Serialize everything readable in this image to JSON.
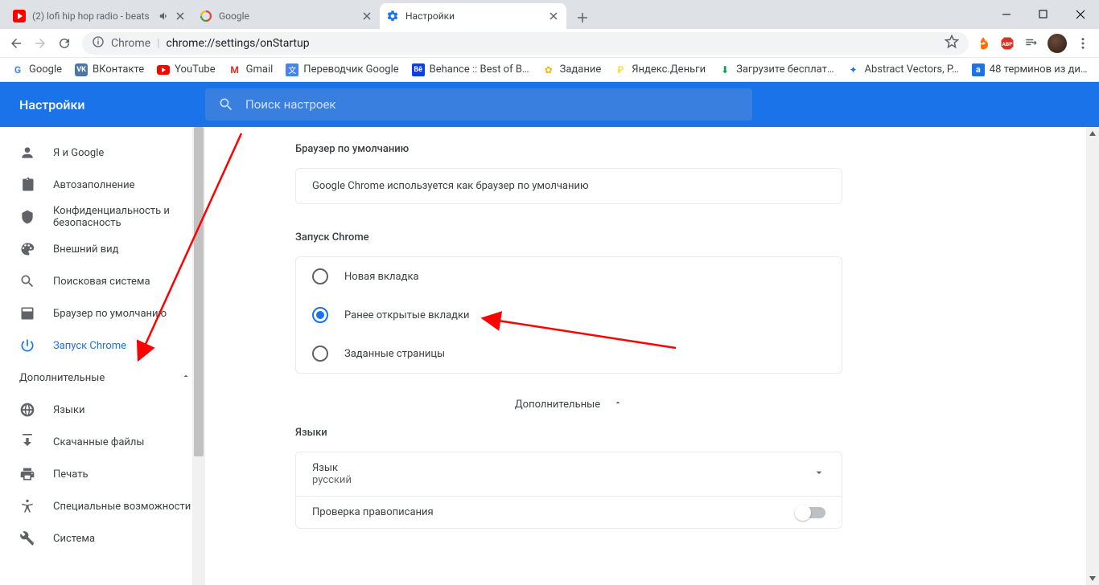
{
  "tabs": [
    {
      "title": "(2) lofi hip hop radio - beats",
      "favicon": "youtube",
      "audio": true
    },
    {
      "title": "Google",
      "favicon": "google"
    },
    {
      "title": "Настройки",
      "favicon": "settings",
      "active": true
    }
  ],
  "omnibox": {
    "chip": "Chrome",
    "url": "chrome://settings/onStartup"
  },
  "bookmarks": [
    {
      "label": "Google",
      "icon": "G",
      "color": "#4285f4"
    },
    {
      "label": "ВКонтакте",
      "icon": "VK",
      "color": "#4a76a8"
    },
    {
      "label": "YouTube",
      "icon": "▶",
      "color": "#ff0000"
    },
    {
      "label": "Gmail",
      "icon": "M",
      "color": "#d93025"
    },
    {
      "label": "Переводчик Google",
      "icon": "⇄",
      "color": "#4285f4"
    },
    {
      "label": "Behance :: Best of B…",
      "icon": "Bē",
      "color": "#053eff"
    },
    {
      "label": "Задание",
      "icon": "✿",
      "color": "#f4b400"
    },
    {
      "label": "Яндекс.Деньги",
      "icon": "₽",
      "color": "#ffcc00"
    },
    {
      "label": "Загрузите бесплат…",
      "icon": "↓",
      "color": "#0f9d58"
    },
    {
      "label": "Abstract Vectors, P…",
      "icon": "✦",
      "color": "#1a73e8"
    },
    {
      "label": "48 терминов из ди…",
      "icon": "a",
      "color": "#1a73e8"
    }
  ],
  "settings": {
    "title": "Настройки",
    "search_placeholder": "Поиск настроек",
    "nav": {
      "you": "Я и Google",
      "autofill": "Автозаполнение",
      "privacy": "Конфиденциальность и безопасность",
      "appearance": "Внешний вид",
      "search": "Поисковая система",
      "default_browser": "Браузер по умолчанию",
      "on_startup": "Запуск Chrome",
      "advanced": "Дополнительные",
      "languages": "Языки",
      "downloads": "Скачанные файлы",
      "printing": "Печать",
      "accessibility": "Специальные возможности",
      "system": "Система"
    },
    "sections": {
      "default_browser_title": "Браузер по умолчанию",
      "default_browser_text": "Google Chrome используется как браузер по умолчанию",
      "on_startup_title": "Запуск Chrome",
      "radio_newtab": "Новая вкладка",
      "radio_continue": "Ранее открытые вкладки",
      "radio_specific": "Заданные страницы",
      "advanced_toggle": "Дополнительные",
      "languages_title": "Языки",
      "language_label": "Язык",
      "language_value": "русский",
      "spellcheck_label": "Проверка правописания"
    }
  }
}
